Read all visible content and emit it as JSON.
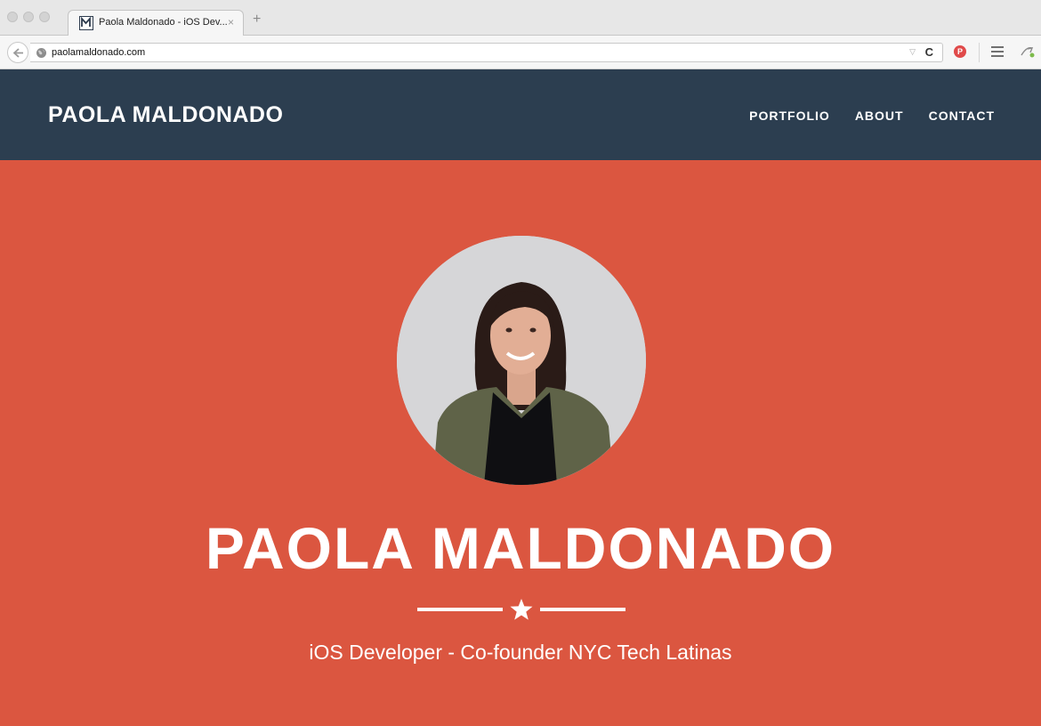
{
  "browser": {
    "tab_title": "Paola Maldonado - iOS Dev...",
    "tab_close": "×",
    "new_tab": "+",
    "url": "paolamaldonado.com",
    "reload": "C",
    "pinterest": "P"
  },
  "site": {
    "brand": "PAOLA MALDONADO",
    "nav": [
      "PORTFOLIO",
      "ABOUT",
      "CONTACT"
    ],
    "colors": {
      "nav_bg": "#2c3e50",
      "hero_bg": "#db5640"
    }
  },
  "hero": {
    "name": "PAOLA MALDONADO",
    "subtitle": "iOS Developer - Co-founder NYC Tech Latinas",
    "divider_icon": "star-icon"
  }
}
